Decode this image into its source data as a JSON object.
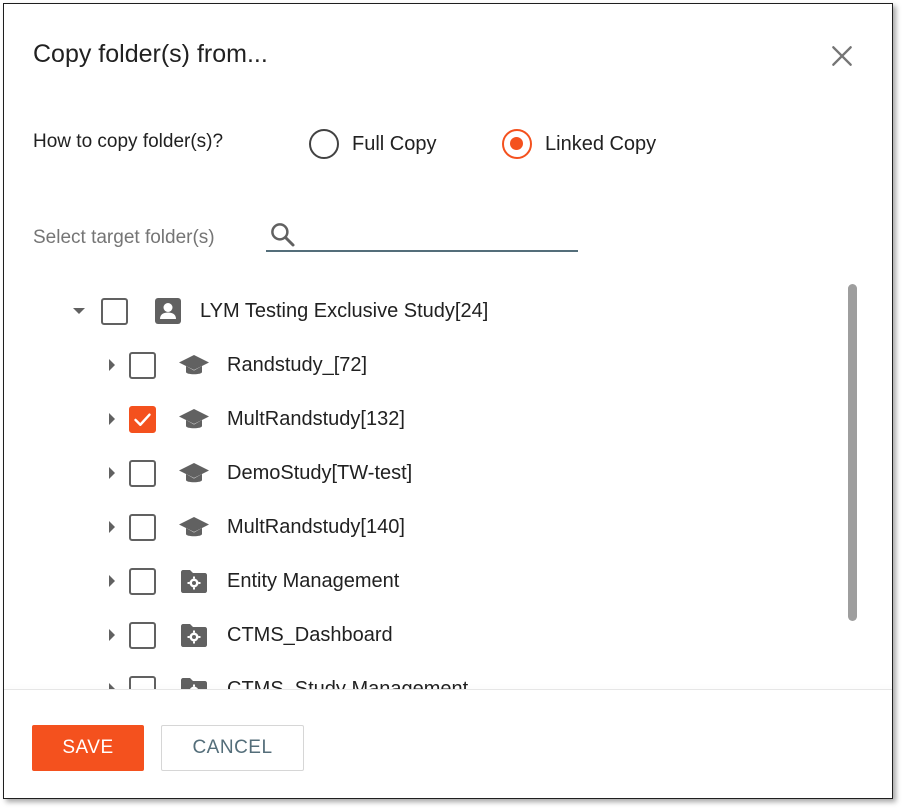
{
  "dialog": {
    "title": "Copy folder(s) from...",
    "close_icon": "close-icon"
  },
  "copy_mode": {
    "label": "How to copy folder(s)?",
    "options": [
      {
        "label": "Full Copy",
        "selected": false
      },
      {
        "label": "Linked Copy",
        "selected": true
      }
    ]
  },
  "target": {
    "label": "Select target folder(s)",
    "search_value": "",
    "search_placeholder": ""
  },
  "tree": {
    "root": {
      "label": "LYM Testing Exclusive Study[24]",
      "icon": "account-box-icon",
      "expanded": true,
      "checked": false
    },
    "children": [
      {
        "label": "Randstudy_[72]",
        "icon": "graduation-cap-icon",
        "checked": false
      },
      {
        "label": "MultRandstudy[132]",
        "icon": "graduation-cap-icon",
        "checked": true
      },
      {
        "label": "DemoStudy[TW-test]",
        "icon": "graduation-cap-icon",
        "checked": false
      },
      {
        "label": "MultRandstudy[140]",
        "icon": "graduation-cap-icon",
        "checked": false
      },
      {
        "label": "Entity Management",
        "icon": "folder-settings-icon",
        "checked": false
      },
      {
        "label": "CTMS_Dashboard",
        "icon": "folder-settings-icon",
        "checked": false
      },
      {
        "label": "CTMS_Study Management",
        "icon": "folder-settings-icon",
        "checked": false
      }
    ]
  },
  "buttons": {
    "save": "SAVE",
    "cancel": "CANCEL"
  },
  "colors": {
    "accent": "#f4511e",
    "cancel_text": "#546e7a",
    "icon_gray": "#616161"
  }
}
